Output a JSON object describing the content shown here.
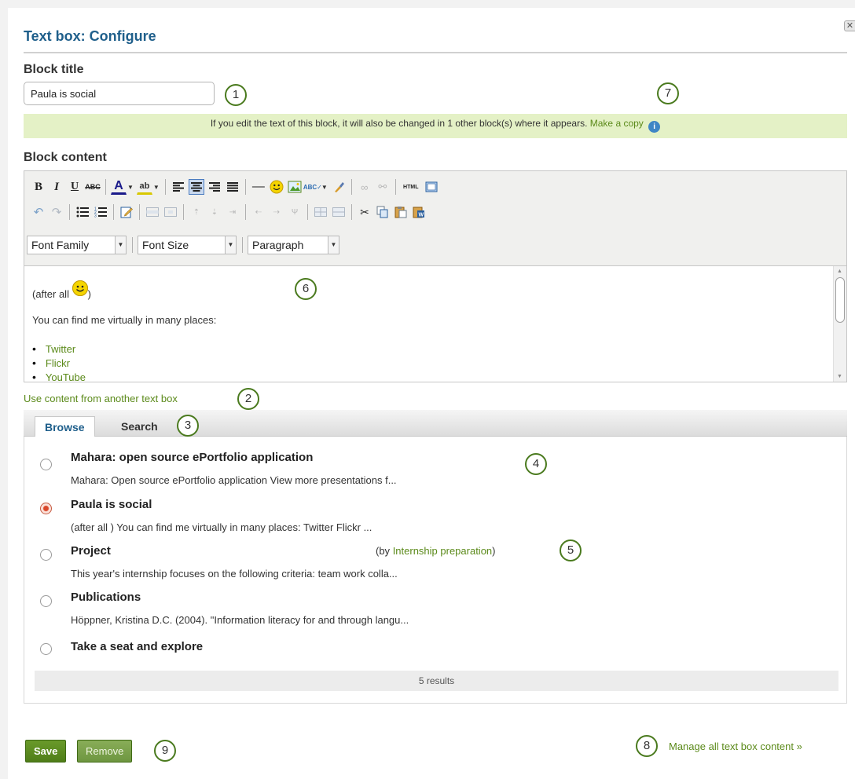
{
  "window": {
    "title": "Text box: Configure",
    "close_glyph": "✕"
  },
  "block_title": {
    "label": "Block title",
    "value": "Paula is social"
  },
  "notice": {
    "text": "If you edit the text of this block, it will also be changed in 1 other block(s) where it appears.",
    "link": "Make a copy",
    "icon": "info-icon"
  },
  "block_content": {
    "label": "Block content",
    "toolbar": {
      "font_family": "Font Family",
      "font_size": "Font Size",
      "format": "Paragraph",
      "html_label": "HTML"
    },
    "body": {
      "line1_prefix": "(after all",
      "line1_suffix": ")",
      "line2": "You can find me virtually in many places:",
      "links": [
        "Twitter",
        "Flickr",
        "YouTube"
      ]
    }
  },
  "use_content_link": "Use content from another text box",
  "tabs": [
    {
      "label": "Browse",
      "active": true
    },
    {
      "label": "Search",
      "active": false
    }
  ],
  "results": [
    {
      "title": "Mahara: open source ePortfolio application",
      "desc": "Mahara: Open source ePortfolio application View more presentations f...",
      "checked": false
    },
    {
      "title": "Paula is social",
      "desc": "(after all ) You can find me virtually in many places: Twitter Flickr ...",
      "checked": true
    },
    {
      "title": "Project",
      "desc": "This year's internship focuses on the following criteria: team work colla...",
      "checked": false,
      "owner_prefix": "(by",
      "owner_link": "Internship preparation",
      "owner_suffix": ")"
    },
    {
      "title": "Publications",
      "desc": "Höppner, Kristina D.C. (2004). \"Information literacy for and through langu...",
      "checked": false
    },
    {
      "title": "Take a seat and explore",
      "desc": "",
      "checked": false
    }
  ],
  "results_count": "5 results",
  "manage_link": "Manage all text box content »",
  "buttons": {
    "save": "Save",
    "remove": "Remove"
  },
  "callouts": [
    "1",
    "2",
    "3",
    "4",
    "5",
    "6",
    "7",
    "8",
    "9"
  ],
  "colors": {
    "accent_title": "#1f5f8b",
    "link": "#5b8a1a",
    "notice_bg": "#e4f1c6",
    "save_bg": "#5a8a1f"
  }
}
